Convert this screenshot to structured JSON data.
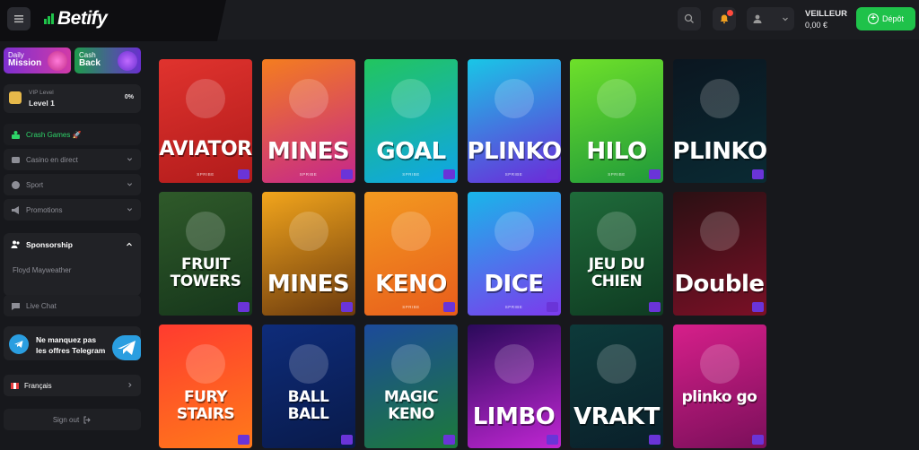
{
  "header": {
    "logo": "Betify",
    "user_name": "VEILLEUR",
    "balance": "0,00 €",
    "deposit_label": "Dépôt",
    "colors": {
      "accent": "#1fc24a",
      "notification": "#ff4a3d"
    }
  },
  "sidebar": {
    "promos": [
      {
        "line1": "Daily",
        "line2": "Mission"
      },
      {
        "line1": "Cash",
        "line2": "Back"
      }
    ],
    "vip": {
      "label": "VIP Level",
      "level": "Level 1",
      "percent": "0%"
    },
    "nav": [
      {
        "label": "Crash Games 🚀",
        "icon": "rocket-icon"
      },
      {
        "label": "Casino en direct",
        "icon": "casino-icon"
      },
      {
        "label": "Sport",
        "icon": "ball-icon"
      },
      {
        "label": "Promotions",
        "icon": "megaphone-icon"
      }
    ],
    "sponsorship": {
      "title": "Sponsorship",
      "item": "Floyd Mayweather"
    },
    "live_chat": "Live Chat",
    "telegram": {
      "line1": "Ne manquez pas",
      "line2": "les offres Telegram"
    },
    "language": "Français",
    "sign_out": "Sign out"
  },
  "games": [
    {
      "title": "AVIATOR",
      "provider": "SPRIBE",
      "bg": "linear-gradient(160deg,#e0332e,#b11b1b)"
    },
    {
      "title": "MINES",
      "provider": "SPRIBE",
      "bg": "linear-gradient(160deg,#f47d1f,#c5268c)"
    },
    {
      "title": "GOAL",
      "provider": "SPRIBE",
      "bg": "linear-gradient(160deg,#22c55e,#0ea5e9)"
    },
    {
      "title": "PLINKO",
      "provider": "SPRIBE",
      "bg": "linear-gradient(160deg,#19c6e6,#6d28d9)"
    },
    {
      "title": "HILO",
      "provider": "SPRIBE",
      "bg": "linear-gradient(160deg,#6ee02a,#1f9a3a)"
    },
    {
      "title": "PLINKO",
      "provider": "",
      "bg": "linear-gradient(160deg,#0b1620,#0a2a33)"
    },
    {
      "title": "FRUIT TOWERS",
      "provider": "",
      "bg": "linear-gradient(160deg,#2f5a2a,#16361b)"
    },
    {
      "title": "MINES",
      "provider": "",
      "bg": "linear-gradient(160deg,#f2a51c,#6b3a0e)"
    },
    {
      "title": "KENO",
      "provider": "SPRIBE",
      "bg": "linear-gradient(160deg,#f39a20,#e85d1c)"
    },
    {
      "title": "DICE",
      "provider": "SPRIBE",
      "bg": "linear-gradient(160deg,#19b6ea,#7c3aed)"
    },
    {
      "title": "JEU DU CHIEN",
      "provider": "",
      "bg": "linear-gradient(160deg,#1f6b3a,#0f3b22)"
    },
    {
      "title": "Double",
      "provider": "",
      "bg": "linear-gradient(160deg,#2a1013,#7a1026)"
    },
    {
      "title": "FURY STAIRS",
      "provider": "",
      "bg": "linear-gradient(160deg,#ff3b2f,#ff7a1a)"
    },
    {
      "title": "BALL BALL",
      "provider": "",
      "bg": "linear-gradient(160deg,#0e2c7a,#091a4a)"
    },
    {
      "title": "MAGIC KENO",
      "provider": "",
      "bg": "linear-gradient(160deg,#1c4a9a,#1c7a3a)"
    },
    {
      "title": "LIMBO",
      "provider": "",
      "bg": "linear-gradient(160deg,#2a0a5a,#c026d3)"
    },
    {
      "title": "VRAKT",
      "provider": "",
      "bg": "linear-gradient(160deg,#0d3a3a,#0a1f2a)"
    },
    {
      "title": "plinko go",
      "provider": "",
      "bg": "linear-gradient(160deg,#d61f8a,#7a0f5a)"
    }
  ]
}
